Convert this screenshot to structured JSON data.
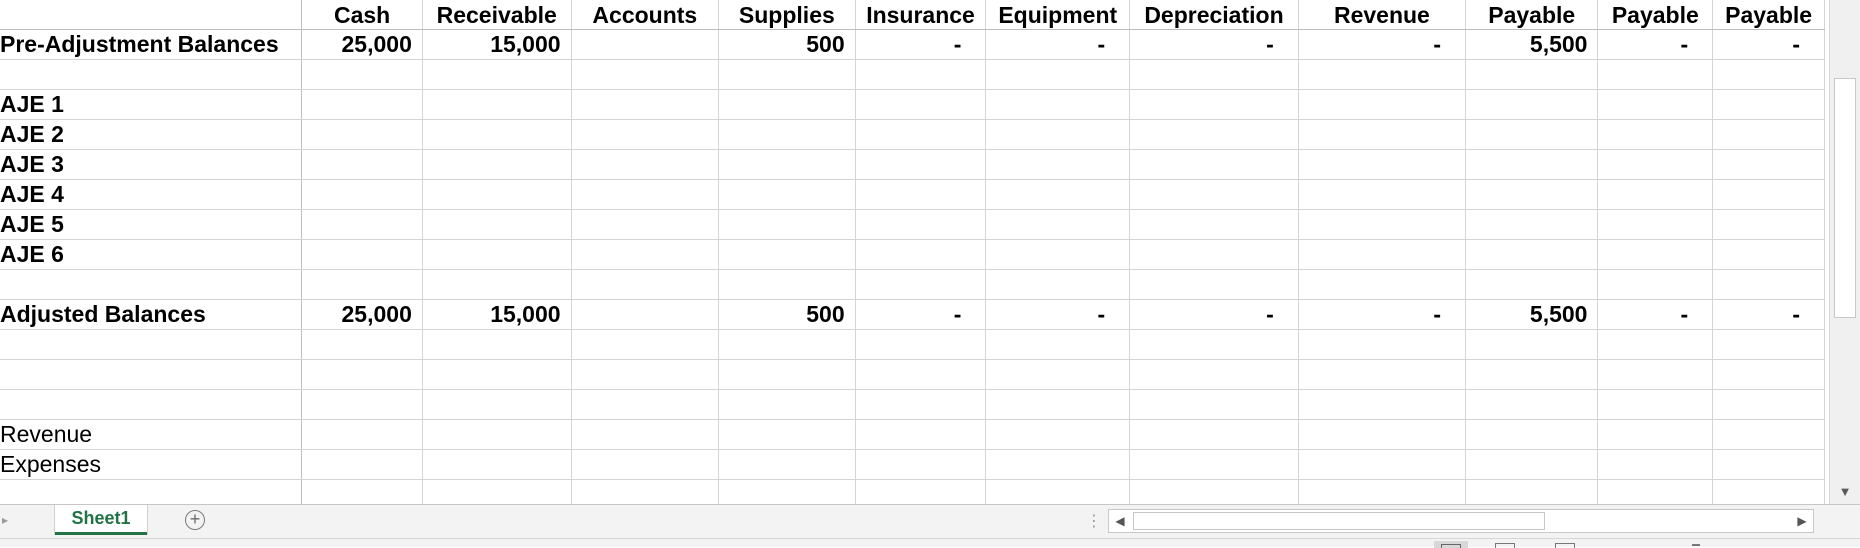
{
  "columns": [
    "",
    "Cash",
    "Receivable",
    "Accounts",
    "Supplies",
    "Insurance",
    "Equipment",
    "Depreciation",
    "Revenue",
    "Payable",
    "Payable",
    "Payable"
  ],
  "rows": [
    {
      "label": "Pre-Adjustment Balances",
      "bold": true,
      "cells": [
        "25,000",
        "15,000",
        "",
        "500",
        "-",
        "-",
        "-",
        "-",
        "5,500",
        "-",
        "-"
      ]
    },
    {
      "label": "",
      "cells": [
        "",
        "",
        "",
        "",
        "",
        "",
        "",
        "",
        "",
        "",
        ""
      ]
    },
    {
      "label": "AJE 1",
      "aje": true,
      "cells": [
        "",
        "",
        "",
        "",
        "",
        "",
        "",
        "",
        "",
        "",
        ""
      ]
    },
    {
      "label": "AJE 2",
      "aje": true,
      "cells": [
        "",
        "",
        "",
        "",
        "",
        "",
        "",
        "",
        "",
        "",
        ""
      ]
    },
    {
      "label": "AJE 3",
      "aje": true,
      "cells": [
        "",
        "",
        "",
        "",
        "",
        "",
        "",
        "",
        "",
        "",
        ""
      ]
    },
    {
      "label": "AJE 4",
      "aje": true,
      "cells": [
        "",
        "",
        "",
        "",
        "",
        "",
        "",
        "",
        "",
        "",
        ""
      ]
    },
    {
      "label": "AJE 5",
      "aje": true,
      "cells": [
        "",
        "",
        "",
        "",
        "",
        "",
        "",
        "",
        "",
        "",
        ""
      ]
    },
    {
      "label": "AJE 6",
      "aje": true,
      "cells": [
        "",
        "",
        "",
        "",
        "",
        "",
        "",
        "",
        "",
        "",
        ""
      ]
    },
    {
      "label": "",
      "cells": [
        "",
        "",
        "",
        "",
        "",
        "",
        "",
        "",
        "",
        "",
        ""
      ]
    },
    {
      "label": "Adjusted Balances",
      "bold": true,
      "cells": [
        "25,000",
        "15,000",
        "",
        "500",
        "-",
        "-",
        "-",
        "-",
        "5,500",
        "-",
        "-"
      ]
    },
    {
      "label": "",
      "cells": [
        "",
        "",
        "",
        "",
        "",
        "",
        "",
        "",
        "",
        "",
        ""
      ]
    },
    {
      "label": "",
      "cells": [
        "",
        "",
        "",
        "",
        "",
        "",
        "",
        "",
        "",
        "",
        ""
      ]
    },
    {
      "label": "",
      "cells": [
        "",
        "",
        "",
        "",
        "",
        "",
        "",
        "",
        "",
        "",
        ""
      ]
    },
    {
      "label": "Revenue",
      "cells": [
        "",
        "",
        "",
        "",
        "",
        "",
        "",
        "",
        "",
        "",
        ""
      ]
    },
    {
      "label": "Expenses",
      "cells": [
        "",
        "",
        "",
        "",
        "",
        "",
        "",
        "",
        "",
        "",
        ""
      ]
    },
    {
      "label": "",
      "cells": [
        "",
        "",
        "",
        "",
        "",
        "",
        "",
        "",
        "",
        "",
        ""
      ]
    }
  ],
  "sheet_tabs": [
    {
      "label": "Sheet1",
      "active": true
    }
  ],
  "add_sheet_symbol": "+",
  "scroll_dots": "⋮",
  "colors": {
    "accent": "#217346",
    "gridline": "#d4d4d4"
  },
  "icons": {
    "add_sheet": "plus-circle-icon",
    "scroll_left": "triangle-left-icon",
    "scroll_right": "triangle-right-icon",
    "scroll_down": "triangle-down-icon",
    "view_normal": "normal-view-icon",
    "view_layout": "page-layout-icon",
    "view_break": "page-break-icon"
  }
}
